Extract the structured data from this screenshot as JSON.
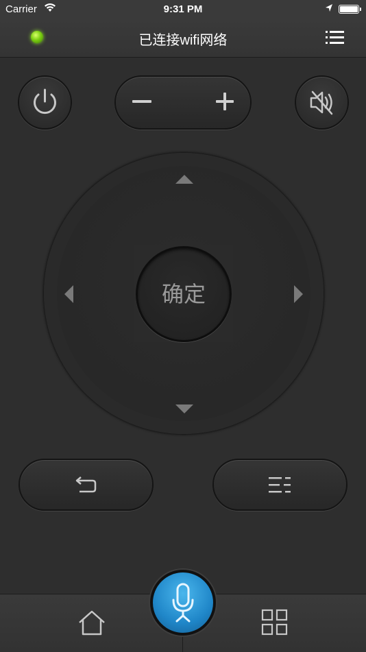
{
  "status_bar": {
    "carrier": "Carrier",
    "time": "9:31 PM",
    "battery_level": 1.0
  },
  "nav": {
    "title": "已连接wifi网络",
    "connection_indicator_color": "#7ccf12"
  },
  "remote": {
    "ok_label": "确定",
    "accent_color": "#2a9ad8"
  },
  "icons": {
    "power": "power-icon",
    "volume_down": "minus-icon",
    "volume_up": "plus-icon",
    "mute": "mute-icon",
    "back": "back-icon",
    "menu": "menu-icon",
    "mic": "microphone-icon",
    "home": "home-icon",
    "apps": "grid-icon",
    "nav_menu": "list-icon"
  }
}
